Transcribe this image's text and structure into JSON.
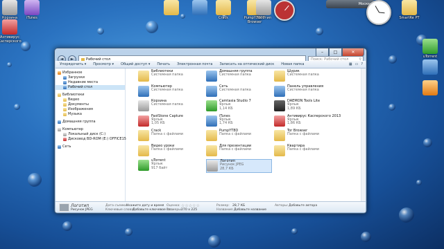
{
  "desktop": {
    "icons": [
      {
        "label": "Корзина",
        "color": "gray"
      },
      {
        "label": "iTunes",
        "color": "purple"
      },
      {
        "label": "Антивирус Касперского",
        "color": "red"
      },
      {
        "label": "",
        "color": "folder"
      },
      {
        "label": "",
        "color": "blue"
      },
      {
        "label": "Crack",
        "color": "folder"
      },
      {
        "label": "PumpYT8DT Browser",
        "color": "folder"
      },
      {
        "label": "Логотип",
        "color": "gray"
      },
      {
        "label": "SmartRe PT",
        "color": "folder"
      },
      {
        "label": "uTorrent",
        "color": "green"
      },
      {
        "label": "",
        "color": "blue"
      },
      {
        "label": "",
        "color": "orange"
      }
    ],
    "weather": "Москва"
  },
  "window": {
    "address": "Рабочий стол",
    "search_placeholder": "Поиск: Рабочий стол",
    "caption": {
      "min": "–",
      "max": "□",
      "close": "✕"
    },
    "nav_buttons": {
      "back": "◄",
      "forward": "►"
    },
    "toolbar": [
      "Упорядочить ▾",
      "Просмотр ▾",
      "Общий доступ ▾",
      "Печать",
      "Электронная почта",
      "Записать на оптический диск",
      "Новая папка"
    ],
    "sidebar": [
      {
        "label": "Избранное",
        "type": "header",
        "color": "orange"
      },
      {
        "label": "Загрузки",
        "type": "item",
        "color": "blue"
      },
      {
        "label": "Недавние места",
        "type": "item",
        "color": "blue"
      },
      {
        "label": "Рабочий стол",
        "type": "item",
        "color": "blue",
        "selected": true
      },
      {
        "label": "",
        "type": "gap"
      },
      {
        "label": "Библиотеки",
        "type": "header",
        "color": "folder"
      },
      {
        "label": "Видео",
        "type": "item",
        "color": "folder"
      },
      {
        "label": "Документы",
        "type": "item",
        "color": "folder"
      },
      {
        "label": "Изображения",
        "type": "item",
        "color": "folder"
      },
      {
        "label": "Музыка",
        "type": "item",
        "color": "folder"
      },
      {
        "label": "",
        "type": "gap"
      },
      {
        "label": "Домашняя группа",
        "type": "header",
        "color": "blue"
      },
      {
        "label": "",
        "type": "gap"
      },
      {
        "label": "Компьютер",
        "type": "header",
        "color": "gray"
      },
      {
        "label": "Локальный диск (C:)",
        "type": "item",
        "color": "gray"
      },
      {
        "label": "Дисковод BD-ROM (E:) OFFICE15",
        "type": "item",
        "color": "red"
      },
      {
        "label": "",
        "type": "gap"
      },
      {
        "label": "Сеть",
        "type": "header",
        "color": "blue"
      }
    ],
    "items": [
      {
        "name": "Библиотеки",
        "sub1": "Системная папка",
        "sub2": "",
        "color": "folder"
      },
      {
        "name": "Домашняя группа",
        "sub1": "Системная папка",
        "sub2": "",
        "color": "blue"
      },
      {
        "name": "Шурик",
        "sub1": "Системная папка",
        "sub2": "",
        "color": "folder"
      },
      {
        "name": "Компьютер",
        "sub1": "Системная папка",
        "sub2": "",
        "color": "blue"
      },
      {
        "name": "Сеть",
        "sub1": "Системная папка",
        "sub2": "",
        "color": "blue"
      },
      {
        "name": "Панель управления",
        "sub1": "Системная папка",
        "sub2": "",
        "color": "blue"
      },
      {
        "name": "Корзина",
        "sub1": "Системная папка",
        "sub2": "",
        "color": "gray"
      },
      {
        "name": "Camtasia Studio 7",
        "sub1": "Ярлык",
        "sub2": "1,14 КБ",
        "color": "green"
      },
      {
        "name": "DAEMON Tools Lite",
        "sub1": "Ярлык",
        "sub2": "1,89 КБ",
        "color": "dark"
      },
      {
        "name": "FastStone Capture",
        "sub1": "Ярлык",
        "sub2": "1,05 КБ",
        "color": "red"
      },
      {
        "name": "iTunes",
        "sub1": "Ярлык",
        "sub2": "1,74 КБ",
        "color": "blue"
      },
      {
        "name": "Антивирус Касперского 2013",
        "sub1": "Ярлык",
        "sub2": "1,86 КБ",
        "color": "red"
      },
      {
        "name": "Crack",
        "sub1": "Папка с файлами",
        "sub2": "",
        "color": "folder"
      },
      {
        "name": "PumpYT8D",
        "sub1": "Папка с файлами",
        "sub2": "",
        "color": "folder"
      },
      {
        "name": "Tor Browser",
        "sub1": "Папка с файлами",
        "sub2": "",
        "color": "folder"
      },
      {
        "name": "Видео уроки",
        "sub1": "Папка с файлами",
        "sub2": "",
        "color": "folder"
      },
      {
        "name": "Для презентации",
        "sub1": "Папка с файлами",
        "sub2": "",
        "color": "folder"
      },
      {
        "name": "Квартира",
        "sub1": "Папка с файлами",
        "sub2": "",
        "color": "folder"
      },
      {
        "name": "uTorrent",
        "sub1": "Ярлык",
        "sub2": "917 байт",
        "color": "green"
      },
      {
        "name": "Логотип",
        "sub1": "Рисунок JPEG",
        "sub2": "28,7 КБ",
        "color": "gray",
        "selected": true
      }
    ],
    "details": {
      "name": "Логотип",
      "type": "Рисунок JPEG",
      "date_label": "Дата съемки:",
      "date_value": "Укажите дату и время",
      "tags_label": "Ключевые слова:",
      "tags_value": "Добавьте ключевое сл...",
      "rating_label": "Оценка:",
      "rating_value": "☆☆☆☆☆",
      "dims_label": "Размеры:",
      "dims_value": "270 x 225",
      "size_label": "Размер:",
      "size_value": "28,7 КБ",
      "title_label": "Название:",
      "title_value": "Добавьте название",
      "authors_label": "Авторы:",
      "authors_value": "Добавьте автора"
    }
  }
}
